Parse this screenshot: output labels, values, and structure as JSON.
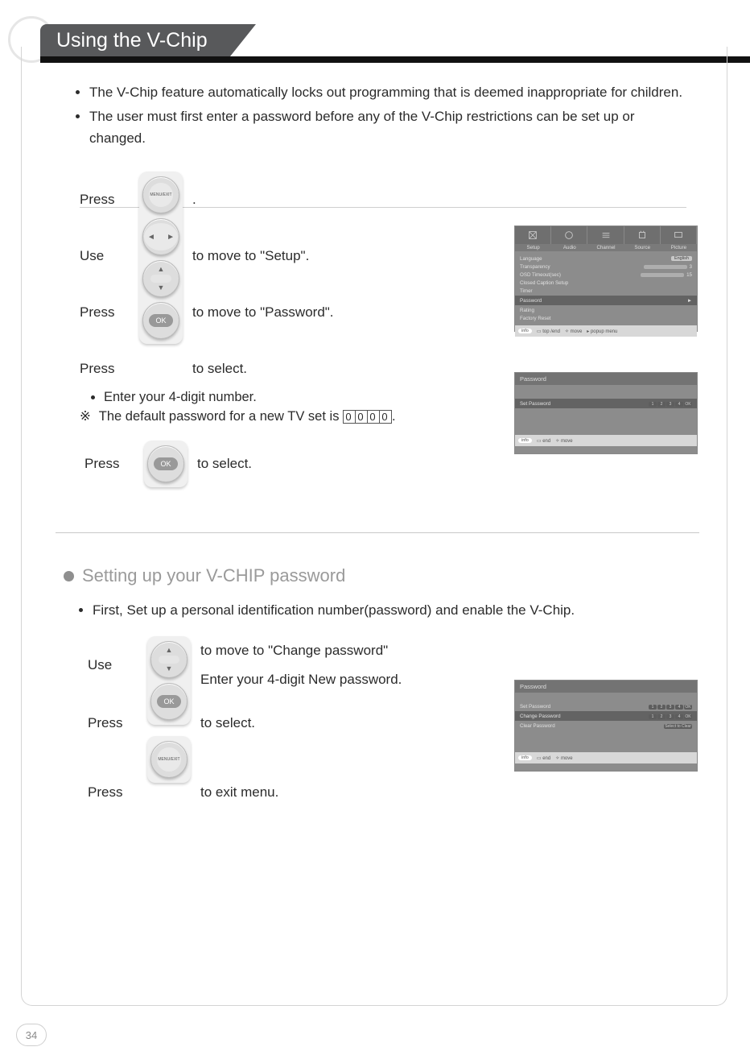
{
  "title": "Using the V-Chip",
  "intro": [
    "The V-Chip feature automatically locks out programming that is deemed inappropriate for children.",
    "The user must first enter a password before any of the V-Chip restrictions can be set up or changed."
  ],
  "steps1": {
    "r1": {
      "verb": "Press",
      "btn": "MENU/EXIT",
      "tail": "."
    },
    "r2": {
      "verb": "Use",
      "btn": "lr",
      "tail": "to move to \"Setup\"."
    },
    "r3": {
      "verb": "Press",
      "btn": "ud",
      "tail": "to move to \"Password\"."
    },
    "r4": {
      "verb": "Press",
      "btn": "OK",
      "tail": "to select."
    }
  },
  "note1_bullet": "Enter your  4-digit number.",
  "note1_line": "The default password for a new TV set is",
  "default_pw": [
    "0",
    "0",
    "0",
    "0"
  ],
  "steps1b": {
    "verb": "Press",
    "btn": "OK",
    "tail": "to select."
  },
  "section2_title": "Setting up your V-CHIP password",
  "intro2": "First, Set up a personal identification number(password) and enable the V-Chip.",
  "steps2": {
    "r1": {
      "verb": "Use",
      "btn": "ud",
      "tail": "to move to \"Change password\"",
      "tail2": "Enter your 4-digit New password."
    },
    "r2": {
      "verb": "Press",
      "btn": "OK",
      "tail": "to select."
    },
    "r3": {
      "verb": "Press",
      "btn": "MENU/EXIT",
      "tail": "to exit menu."
    }
  },
  "tv1": {
    "tabs": [
      "Setup",
      "Audio",
      "Channel",
      "Source",
      "Picture"
    ],
    "items": [
      "Language",
      "Transparency",
      "OSD Timeout(sec)",
      "Closed Caption Setup",
      "Timer",
      "Password",
      "Rating",
      "Factory Reset"
    ],
    "lang_val": "English",
    "transp_val": "3",
    "osd_val": "15",
    "foot": {
      "info": "info",
      "a": "top /end",
      "b": "move",
      "c": "popup menu"
    }
  },
  "tv2": {
    "head": "Password",
    "row": "Set Password",
    "digits": [
      "1",
      "2",
      "3",
      "4",
      "OK"
    ],
    "foot": {
      "info": "info",
      "a": "end",
      "b": "move"
    }
  },
  "tv3": {
    "head": "Password",
    "rows": [
      {
        "label": "Set Password",
        "d": [
          "1",
          "2",
          "3",
          "4",
          "OK"
        ]
      },
      {
        "label": "Change Password",
        "d": [
          "1",
          "2",
          "3",
          "4",
          "OK"
        ],
        "hl": true
      },
      {
        "label": "Clear Password",
        "d": [
          "Select to Clear"
        ]
      }
    ],
    "foot": {
      "info": "info",
      "a": "end",
      "b": "move"
    }
  },
  "page_number": "34"
}
